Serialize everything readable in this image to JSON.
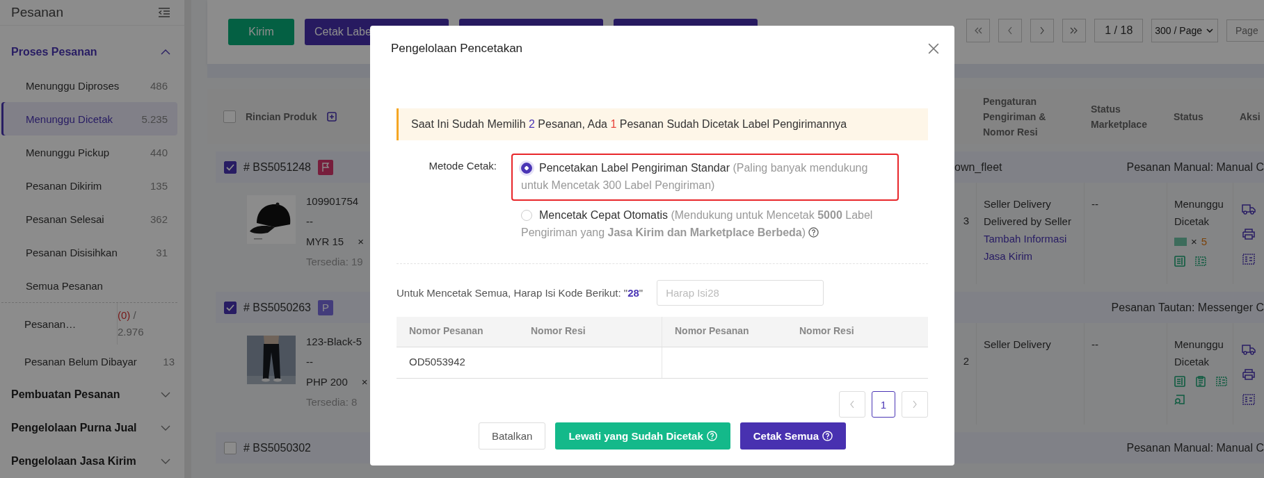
{
  "sidebar": {
    "title": "Pesanan",
    "sections": [
      {
        "title": "Proses Pesanan",
        "expanded": true,
        "groups": [
          [
            {
              "label": "Menunggu Diproses",
              "count": "486",
              "selected": false,
              "kind": "plain"
            },
            {
              "label": "Menunggu Dicetak",
              "count": "5.235",
              "selected": true,
              "kind": "plain"
            },
            {
              "label": "Menunggu Pickup",
              "count": "440",
              "selected": false,
              "kind": "plain"
            },
            {
              "label": "Pesanan Dikirim",
              "count": "135",
              "selected": false,
              "kind": "plain"
            },
            {
              "label": "Pesanan Selesai",
              "count": "362",
              "selected": false,
              "kind": "plain"
            },
            {
              "label": "Pesanan Disisihkan",
              "count": "31",
              "selected": false,
              "kind": "plain"
            },
            {
              "label": "Semua Pesanan",
              "selected": false,
              "kind": "plain"
            }
          ],
          [
            {
              "label": "Pesanan…",
              "flag_count": "(0)",
              "count": "/ 2.976",
              "selected": false,
              "kind": "split"
            },
            {
              "label": "Pesanan Belum Dibayar",
              "count": "13",
              "selected": false,
              "kind": "plain"
            }
          ]
        ]
      },
      {
        "title": "Pembuatan Pesanan",
        "expanded": false
      },
      {
        "title": "Pengelolaan Purna Jual",
        "expanded": false
      },
      {
        "title": "Pengelolaan Jasa Kirim",
        "expanded": false
      }
    ]
  },
  "toolbar": {
    "buttons": [
      {
        "label": "Kirim",
        "kind": "success"
      },
      {
        "label": "Cetak Labe",
        "kind": "primary"
      },
      {
        "kind": "primary"
      },
      {
        "kind": "primary"
      }
    ],
    "pagination": {
      "page": "1 / 18",
      "page_size": "300 / Page",
      "jump_placeholder": "Page"
    }
  },
  "table": {
    "header_checked": false,
    "columns": [
      {
        "label": "Rincian Produk"
      },
      {
        "label": "Pengaturan Pengiriman & Nomor Resi"
      },
      {
        "label": "Status Marketplace"
      },
      {
        "label": "Status"
      },
      {
        "label": "Aksi"
      }
    ],
    "orders": [
      {
        "number": "# BS5051248",
        "checked": true,
        "badge": {
          "kind": "flag"
        },
        "fleet": "own_fleet",
        "source": "Pesanan Manual: Manual C",
        "items": [
          {
            "sku": "109901754",
            "variant": "--",
            "price": "MYR 15",
            "times": "×",
            "stock": "Tersedia: 19",
            "qty": "3",
            "shipping": [
              "Seller Delivery",
              "Delivered by Seller"
            ],
            "shipping_link": "Tambah Informasi Jasa Kirim",
            "marketplace_status": "--",
            "status": "Menunggu Dicetak",
            "barcode_times": "×",
            "label_count": "5",
            "status_icons": [
              {
                "kind": "doc"
              },
              {
                "kind": "receipt"
              }
            ]
          }
        ]
      },
      {
        "number": "# BS5050263",
        "checked": true,
        "badge": {
          "kind": "letter",
          "text": "P"
        },
        "source": "Pesanan Tautan: Messenger C",
        "items": [
          {
            "sku": "123-Black-5",
            "variant": "--",
            "price": "PHP 200",
            "times": "×",
            "stock": "Tersedia: 8",
            "qty": "2",
            "shipping": [
              "Seller Delivery"
            ],
            "marketplace_status": "--",
            "status": "Menunggu Dicetak",
            "status_icons": [
              {
                "kind": "doc"
              },
              {
                "kind": "list"
              },
              {
                "kind": "receipt"
              },
              {
                "kind": "search"
              }
            ]
          }
        ]
      },
      {
        "number": "# BS5050302",
        "checked": false,
        "source": "Pesanan Manual: Manual C"
      }
    ]
  },
  "modal": {
    "title": "Pengelolaan Pencetakan",
    "alert": [
      {
        "text": "Saat Ini Sudah Memilih "
      },
      {
        "text": "2",
        "color": "#4a35b5"
      },
      {
        "text": " Pesanan, Ada "
      },
      {
        "text": "1",
        "color": "#e8453c"
      },
      {
        "text": " Pesanan Sudah Dicetak Label Pengirimannya"
      }
    ],
    "method": {
      "label": "Metode Cetak:",
      "options": [
        {
          "title": "Pencetakan Label Pengiriman Standar",
          "note": "(Paling banyak mendukung untuk Mencetak 300 Label Pengiriman)",
          "selected": true,
          "highlighted": true,
          "help": false
        },
        {
          "title": "Mencetak Cepat Otomatis",
          "note": "(Mendukung untuk Mencetak **5000** Label Pengiriman yang **Jasa Kirim dan Marketplace Berbeda**)",
          "selected": false,
          "highlighted": false,
          "help": true
        }
      ]
    },
    "code": {
      "prompt": "Untuk Mencetak Semua, Harap Isi Kode Berikut: \"**28**\"",
      "placeholder": "Harap Isi28"
    },
    "table": {
      "columns": [
        "Nomor Pesanan",
        "Nomor Resi",
        "Nomor Pesanan",
        "Nomor Resi"
      ],
      "rows": [
        {
          "cells": [
            "OD5053942"
          ]
        }
      ]
    },
    "pager": [
      {
        "label": "1",
        "selected": true
      }
    ],
    "buttons": [
      {
        "label": "Batalkan",
        "kind": "default",
        "help": false
      },
      {
        "label": "Lewati yang Sudah Dicetak",
        "kind": "success",
        "help": true
      },
      {
        "label": "Cetak Semua",
        "kind": "primary",
        "help": true
      }
    ]
  }
}
